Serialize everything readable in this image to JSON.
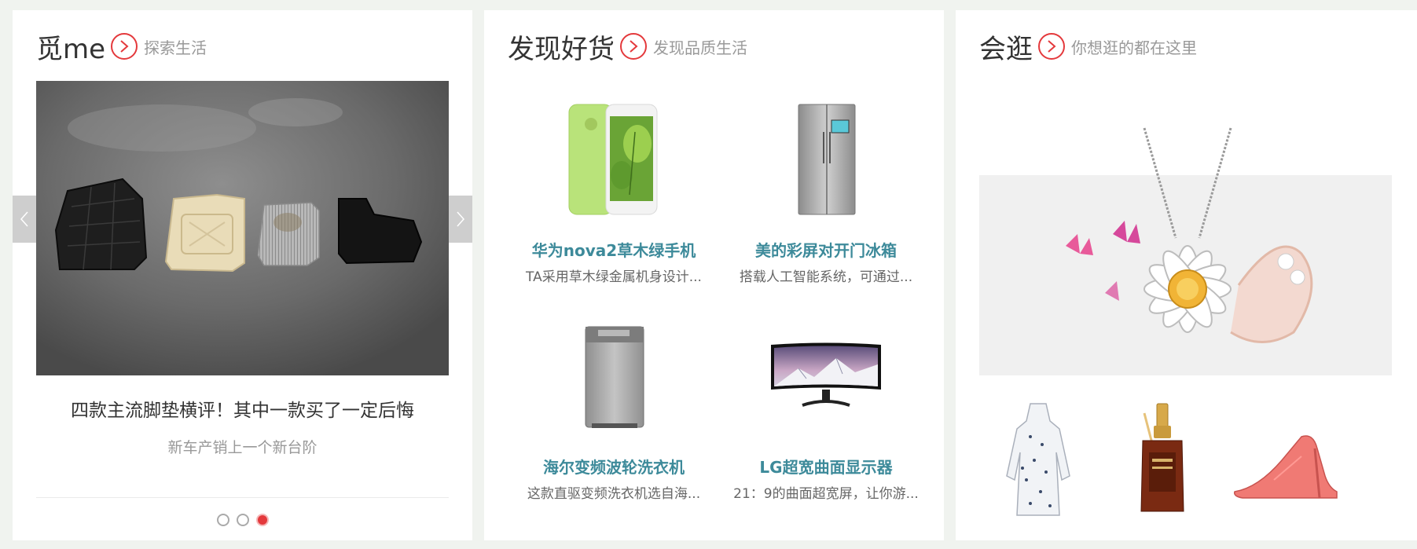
{
  "panels": {
    "mime": {
      "title": "觅me",
      "subtitle": "探索生活",
      "slide_title": "四款主流脚垫横评！其中一款买了一定后悔",
      "slide_subtitle": "新车产销上一个新台阶",
      "dots_total": 3,
      "active_dot": 3
    },
    "discover": {
      "title": "发现好货",
      "subtitle": "发现品质生活",
      "products": [
        {
          "name": "华为nova2草木绿手机",
          "desc": "TA采用草木绿金属机身设计...",
          "icon": "phone-icon"
        },
        {
          "name": "美的彩屏对开门冰箱",
          "desc": "搭载人工智能系统，可通过...",
          "icon": "fridge-icon"
        },
        {
          "name": "海尔变频波轮洗衣机",
          "desc": "这款直驱变频洗衣机选自海...",
          "icon": "washer-icon"
        },
        {
          "name": "LG超宽曲面显示器",
          "desc": "21：9的曲面超宽屏，让你游...",
          "icon": "monitor-icon"
        }
      ]
    },
    "browse": {
      "title": "会逛",
      "subtitle": "你想逛的都在这里",
      "hero_icon": "necklace-image",
      "thumbs": [
        "dress-image",
        "serum-bottle-image",
        "high-heel-image"
      ]
    }
  },
  "colors": {
    "accent": "#e4393c",
    "product_name": "#3d8a9a",
    "muted": "#999999",
    "page_bg": "#f0f3ef"
  }
}
